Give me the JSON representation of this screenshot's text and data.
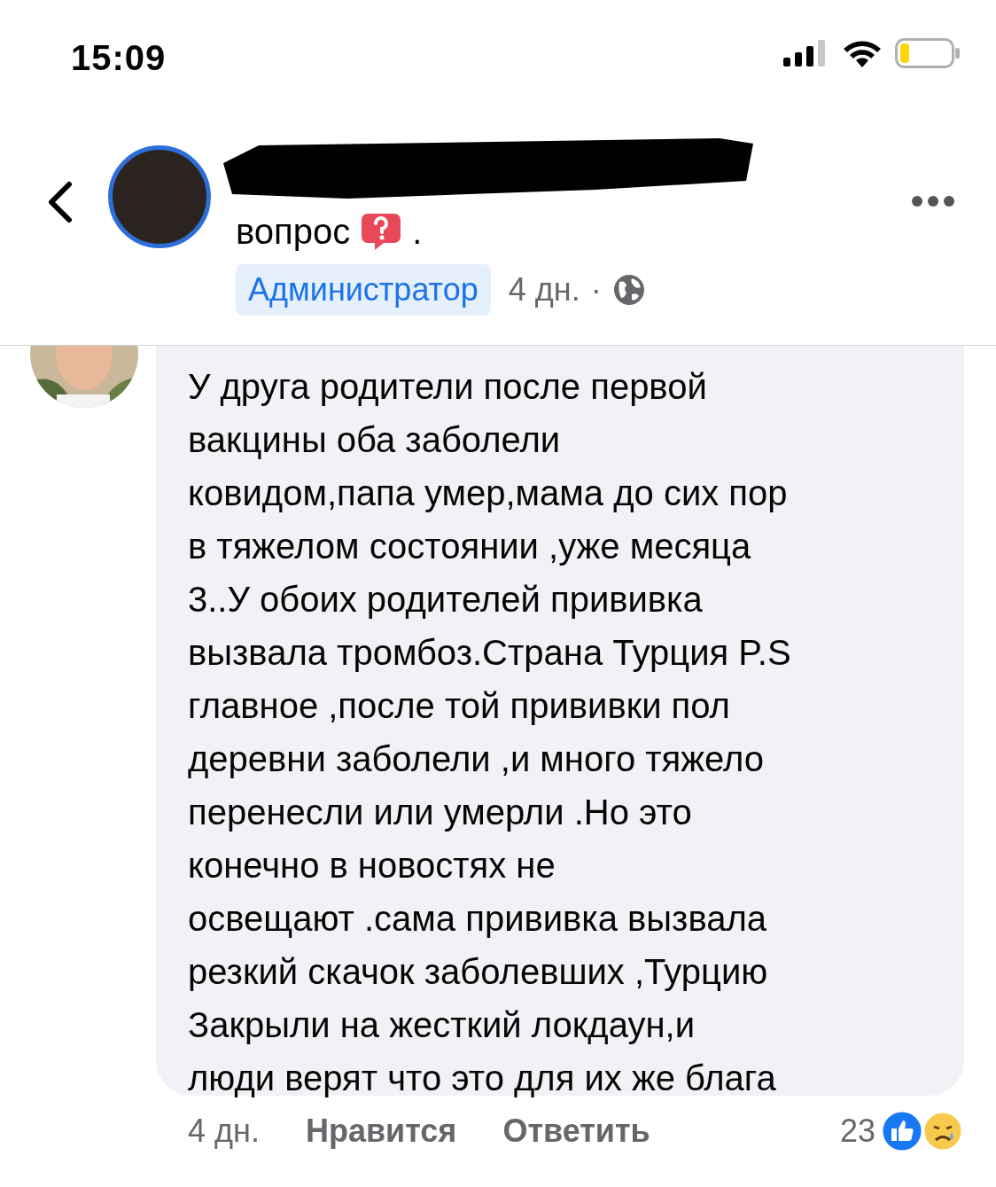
{
  "status_bar": {
    "time": "15:09"
  },
  "post_header": {
    "title_end": "вопрос",
    "title_suffix": ".",
    "badge": "Администратор",
    "time": "4 дн.",
    "separator": "·"
  },
  "comment": {
    "lines": [
      "У друга родители после первой",
      "вакцины оба заболели",
      "ковидом,папа умер,мама до сих пор",
      "в тяжелом состоянии ,уже месяца",
      "3..У обоих родителей прививка",
      "вызвала тромбоз.Страна Турция P.S",
      "главное ,после той прививки пол",
      "деревни заболели ,и много тяжело",
      "перенесли или умерли .Но это",
      "конечно в новостях не",
      "освещают .сама прививка вызвала",
      "резкий скачок  заболевших ,Турцию",
      "Закрыли на жесткий  локдаун,и",
      "люди верят что это для их же блага"
    ],
    "time": "4 дн.",
    "like": "Нравится",
    "reply": "Ответить",
    "reaction_count": "23"
  }
}
